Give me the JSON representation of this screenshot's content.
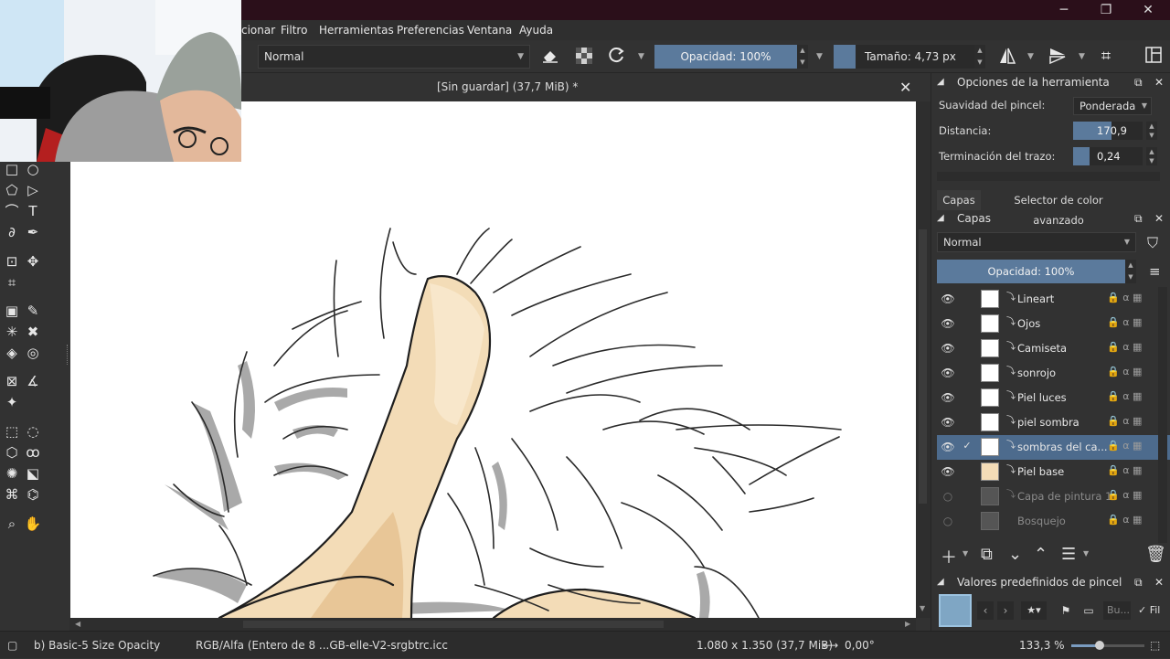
{
  "window": {
    "minimize_glyph": "─",
    "maximize_glyph": "❐",
    "close_glyph": "✕"
  },
  "menubar": {
    "items": [
      "cionar",
      "Filtro",
      "Herramientas",
      "Preferencias",
      "Ventana",
      "Ayuda"
    ]
  },
  "toolbar": {
    "blend_mode": "Normal",
    "opacity_label": "Opacidad: 100%",
    "size_label": "Tamaño: 4,73 px"
  },
  "canvas": {
    "document_title": "[Sin guardar]  (37,7 MiB) *",
    "close_glyph": "✕"
  },
  "tool_options": {
    "title": "Opciones de la herramienta",
    "smoothing_label": "Suavidad del pincel:",
    "smoothing_value": "Ponderada",
    "distance_label": "Distancia:",
    "distance_value": "170,9",
    "stroke_ending_label": "Terminación del trazo:",
    "stroke_ending_value": "0,24"
  },
  "docker_tabs": {
    "tab1": "Capas",
    "tab2": "Selector de color avanzado"
  },
  "layers": {
    "title": "Capas",
    "blend_mode": "Normal",
    "opacity_label": "Opacidad:  100%",
    "items": [
      {
        "name": "Lineart",
        "visible": true,
        "active": false,
        "dim": false
      },
      {
        "name": "Ojos",
        "visible": true,
        "active": false,
        "dim": false
      },
      {
        "name": "Camiseta",
        "visible": true,
        "active": false,
        "dim": false
      },
      {
        "name": "sonrojo",
        "visible": true,
        "active": false,
        "dim": false
      },
      {
        "name": "Piel luces",
        "visible": true,
        "active": false,
        "dim": false
      },
      {
        "name": "piel sombra",
        "visible": true,
        "active": false,
        "dim": false
      },
      {
        "name": "sombras del ca...",
        "visible": true,
        "active": true,
        "dim": false
      },
      {
        "name": "Piel base",
        "visible": true,
        "active": false,
        "dim": false
      },
      {
        "name": "Capa de pintura 1",
        "visible": false,
        "active": false,
        "dim": true
      },
      {
        "name": "Bosquejo",
        "visible": false,
        "active": false,
        "dim": true
      }
    ]
  },
  "brush_presets": {
    "title": "Valores predefinidos de pincel",
    "search_placeholder": "Bu...",
    "filter_label": "Fil"
  },
  "statusbar": {
    "brush_name": "b) Basic-5 Size Opacity",
    "color_profile": "RGB/Alfa (Entero de 8 ...GB-elle-V2-srgbtrc.icc",
    "image_size": "1.080 x 1.350 (37,7 MiB)",
    "rotation": "0,00°",
    "zoom": "133,3 %"
  }
}
